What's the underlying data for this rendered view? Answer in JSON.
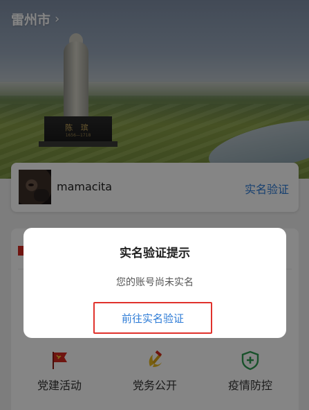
{
  "header": {
    "city": "雷州市",
    "chevron": "›",
    "statue_inscription": "陈 瑸",
    "statue_years": "1656—1718"
  },
  "user_card": {
    "username": "mamacita",
    "verify_label": "实名验证"
  },
  "grid_items": [
    {
      "label": "党建活动",
      "icon": "red-flag-icon"
    },
    {
      "label": "党务公开",
      "icon": "hammer-sickle-icon"
    },
    {
      "label": "疫情防控",
      "icon": "shield-plus-icon"
    }
  ],
  "dialog": {
    "title": "实名验证提示",
    "message": "您的账号尚未实名",
    "button_label": "前往实名验证"
  },
  "colors": {
    "accent_blue": "#2d7bd6",
    "party_red": "#d52a1f",
    "highlight_red": "#e0312b",
    "shield_green": "#2f9b52"
  }
}
